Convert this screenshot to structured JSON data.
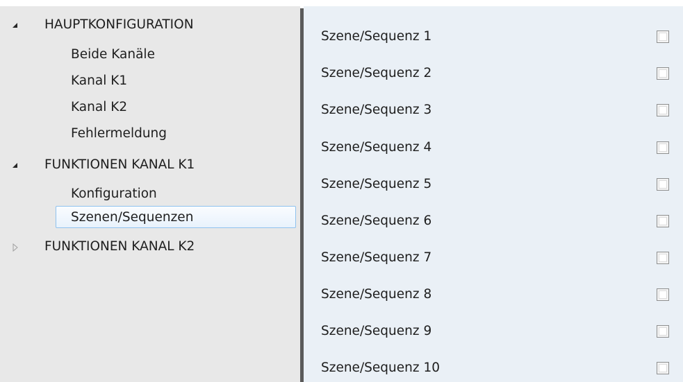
{
  "tree": {
    "items": [
      {
        "label": "HAUPTKONFIGURATION",
        "expander": "expanded-triangle-icon"
      },
      {
        "label": "Beide Kanäle"
      },
      {
        "label": "Kanal K1"
      },
      {
        "label": "Kanal K2"
      },
      {
        "label": "Fehlermeldung"
      },
      {
        "label": "FUNKTIONEN KANAL K1",
        "expander": "expanded-triangle-icon"
      },
      {
        "label": "Konfiguration"
      },
      {
        "label": "Szenen/Sequenzen",
        "selected": true
      },
      {
        "label": "FUNKTIONEN KANAL K2",
        "expander": "collapsed-triangle-icon"
      }
    ]
  },
  "params": {
    "rows": [
      {
        "label": "Szene/Sequenz 1",
        "checked": false
      },
      {
        "label": "Szene/Sequenz 2",
        "checked": false
      },
      {
        "label": "Szene/Sequenz 3",
        "checked": false
      },
      {
        "label": "Szene/Sequenz 4",
        "checked": false
      },
      {
        "label": "Szene/Sequenz 5",
        "checked": false
      },
      {
        "label": "Szene/Sequenz 6",
        "checked": false
      },
      {
        "label": "Szene/Sequenz 7",
        "checked": false
      },
      {
        "label": "Szene/Sequenz 8",
        "checked": false
      },
      {
        "label": "Szene/Sequenz 9",
        "checked": false
      },
      {
        "label": "Szene/Sequenz 10",
        "checked": false
      }
    ]
  },
  "colors": {
    "tree_background": "#e8e8e8",
    "content_background": "#eaf0f6",
    "splitter": "#5a5a5a",
    "selection_border": "#8fc2ee"
  }
}
